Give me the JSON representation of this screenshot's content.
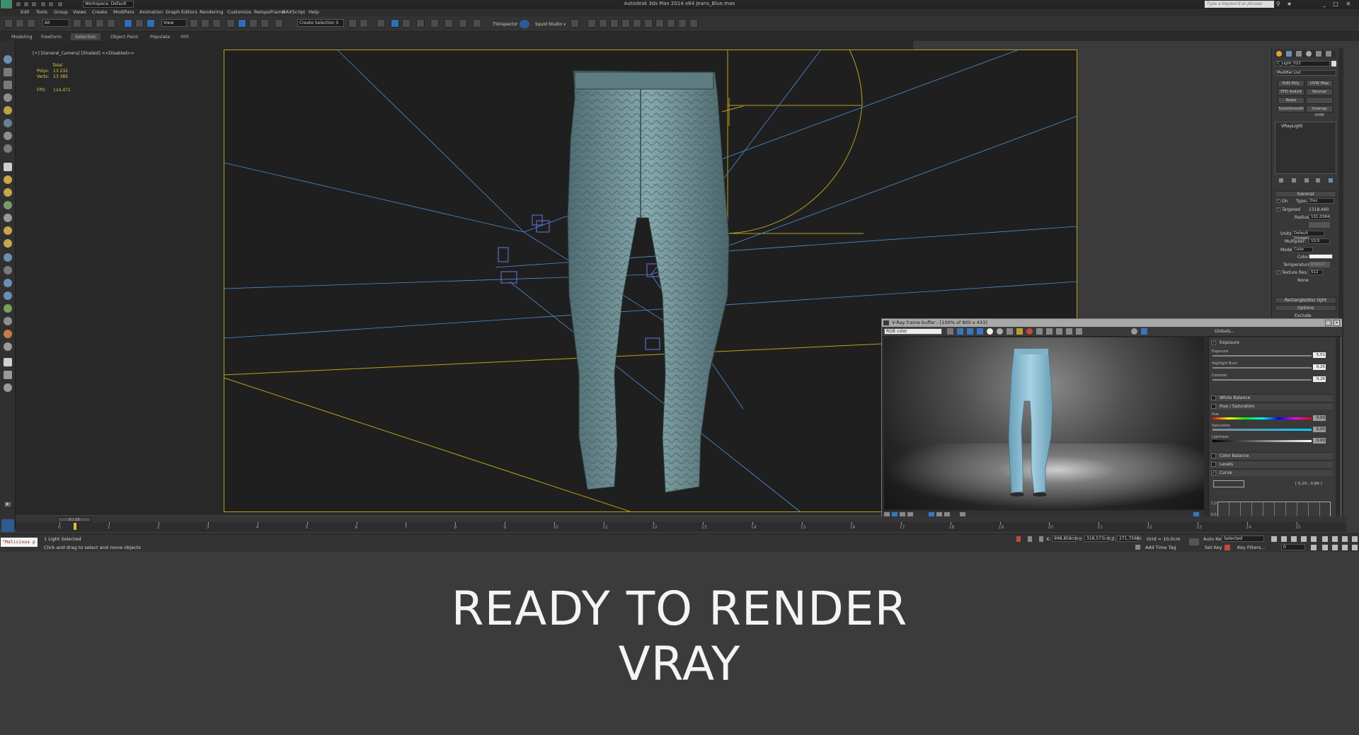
{
  "app": {
    "title": "Autodesk 3ds Max  2014 x64     Jeans_Blue.max",
    "workspace": "Workspace: Default",
    "search_placeholder": "Type a keyword or phrase",
    "window_controls": [
      "_",
      "□",
      "✕"
    ]
  },
  "menu": {
    "items": [
      "Edit",
      "Tools",
      "Group",
      "Views",
      "Create",
      "Modifiers",
      "Animation",
      "Graph Editors",
      "Rendering",
      "Customize",
      "RetopoFrame",
      "MAXScript",
      "Help"
    ]
  },
  "toolbar": {
    "filter": "All",
    "coordinate_system": "View",
    "selection_set": "Create Selection S",
    "plugin_label": "TSInspector",
    "studio_label": "Squid Studio v"
  },
  "ribbon": {
    "tabs": [
      "Modeling",
      "Freeform",
      "Selection",
      "Object Paint",
      "Populate"
    ],
    "active": "Selection"
  },
  "viewport": {
    "label": "[+] [General_Camera] [Shaded]  <<Disabled>>",
    "stats": {
      "header": "Total",
      "polys_label": "Polys:",
      "polys": "13 232",
      "verts_label": "Verts:",
      "verts": "13 385",
      "fps_label": "FPS:",
      "fps": "114,471"
    },
    "colors": {
      "frame": "#b9a21d",
      "light_lines": "#4f8fd6",
      "jeans": "#6f8f95"
    }
  },
  "command_panel": {
    "object_name": "C_Light_012",
    "modifier_list": "Modifier List",
    "mod_buttons": [
      "Edit Poly",
      "UVW Map",
      "FFD 4x4x4",
      "Normal",
      "Relax",
      "",
      "TurboSmooth",
      "Unwrap UVW"
    ],
    "stack_item": "VRayLight",
    "general": {
      "title": "General",
      "on": "On",
      "type_label": "Type:",
      "type": "Disc",
      "targeted": "Targeted",
      "targeted_value": "1318,460",
      "radius_label": "Radius:",
      "radius": "101,0384",
      "units_label": "Units:",
      "units": "Default (image)",
      "multiplier_label": "Multiplier:",
      "multiplier": "10,0",
      "mode_label": "Mode:",
      "mode": "Color",
      "color_label": "Color:",
      "temperature_label": "Temperature:",
      "temperature": "6500,0",
      "texture_label": "Texture",
      "res_label": "Res:",
      "res": "512",
      "none_label": "None"
    },
    "rollouts": [
      "Rectangle/disc light",
      "Options",
      "Exclude"
    ]
  },
  "vfb": {
    "title": "V-Ray frame buffer - [100% of 800 x 433]",
    "channel": "RGB color",
    "globals": "Globals...",
    "exposure": {
      "label": "Exposure",
      "exposure_label": "Exposure",
      "exposure": "5,51",
      "burn_label": "Highlight Burn",
      "burn": "0,25",
      "contrast_label": "Contrast",
      "contrast": "0,26"
    },
    "white_balance": "White Balance",
    "hue_sat": {
      "label": "Hue / Saturation",
      "hue_label": "Hue",
      "hue": "0,00",
      "sat_label": "Saturation",
      "sat": "0,00",
      "light_label": "Lightness",
      "light": "0,00"
    },
    "color_balance": "Color Balance",
    "levels": "Levels",
    "curve": {
      "label": "Curve",
      "value": "[ 0,20 ; 0,89 ]"
    },
    "levels_max": "1,0",
    "levels_min": "0,5"
  },
  "timeline": {
    "position": "0 / 25",
    "ticks": [
      "0",
      "1",
      "2",
      "3",
      "4",
      "5",
      "6",
      "7",
      "8",
      "9",
      "10",
      "11",
      "12",
      "13",
      "14",
      "15",
      "16",
      "17",
      "18",
      "19",
      "20",
      "21",
      "22",
      "23",
      "24",
      "25"
    ]
  },
  "status": {
    "maxscript": "\"Malicious p",
    "selection": "1 Light Selected",
    "prompt": "Click and drag to select and move objects",
    "x_label": "X:",
    "x": "998,858cm",
    "y_label": "Y:",
    "y": "318,573cm",
    "z_label": "Z:",
    "z": "271,7566c",
    "grid": "Grid = 10,0cm",
    "add_time_tag": "Add Time Tag",
    "auto_key": "Auto Key",
    "selected": "Selected",
    "set_key": "Set Key",
    "key_filters": "Key Filters...",
    "frame": "0"
  },
  "caption": {
    "line1": "READY TO RENDER",
    "line2": "VRAY"
  }
}
